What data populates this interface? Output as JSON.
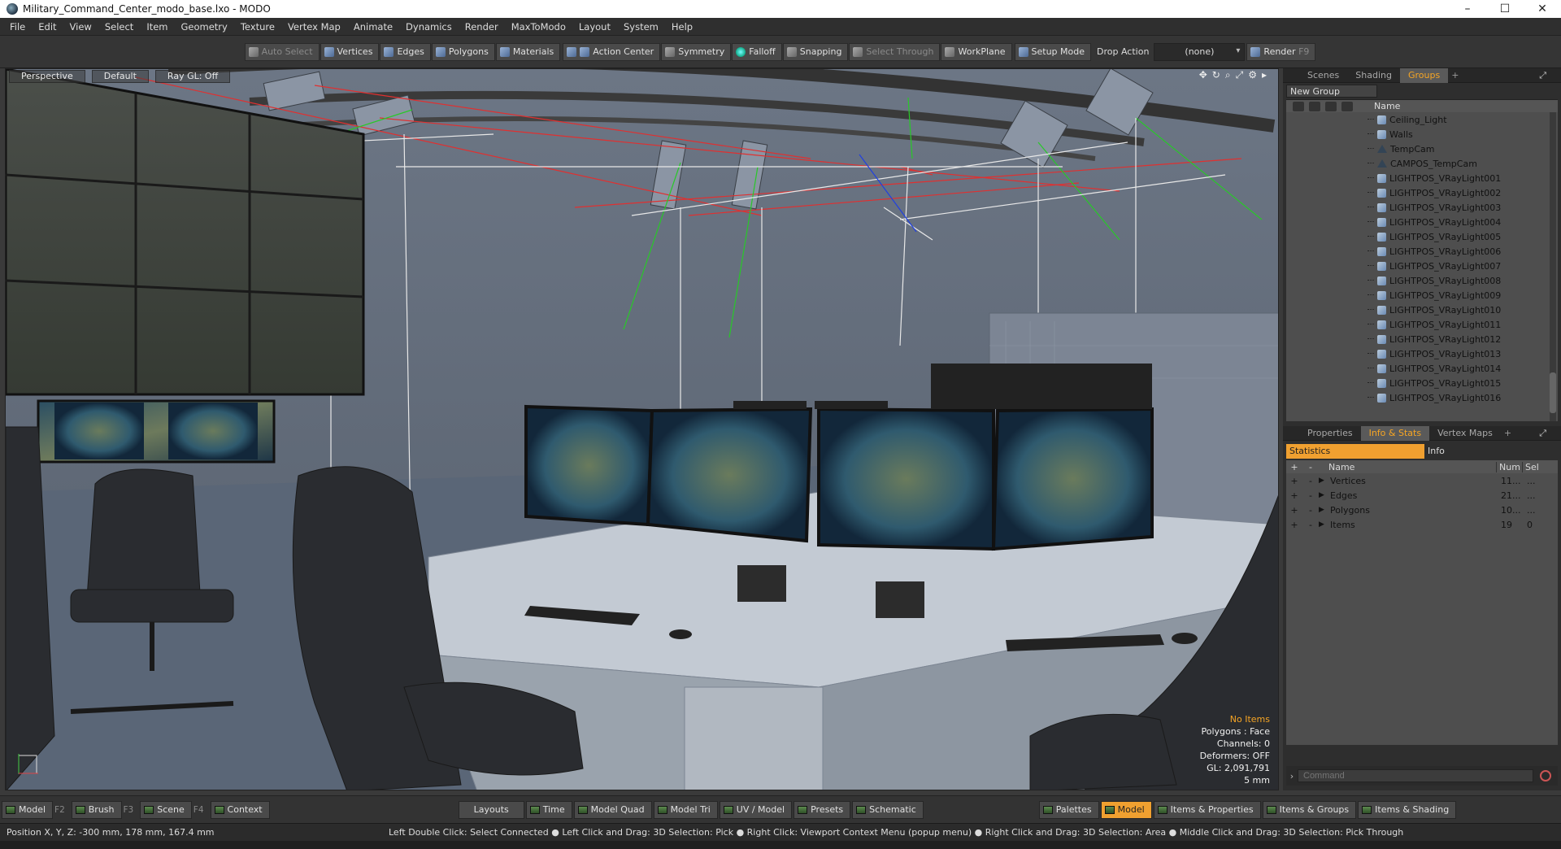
{
  "window": {
    "title": "Military_Command_Center_modo_base.lxo - MODO",
    "min": "–",
    "max": "☐",
    "close": "✕"
  },
  "menu": [
    "File",
    "Edit",
    "View",
    "Select",
    "Item",
    "Geometry",
    "Texture",
    "Vertex Map",
    "Animate",
    "Dynamics",
    "Render",
    "MaxToModo",
    "Layout",
    "System",
    "Help"
  ],
  "toolbar": {
    "auto_select": "Auto Select",
    "vertices": "Vertices",
    "edges": "Edges",
    "polygons": "Polygons",
    "materials": "Materials",
    "action_center": "Action Center",
    "symmetry": "Symmetry",
    "falloff": "Falloff",
    "snapping": "Snapping",
    "select_through": "Select Through",
    "workplane": "WorkPlane",
    "setup_mode": "Setup Mode",
    "drop_action": "Drop Action",
    "drop_value": "(none)",
    "render": "Render",
    "render_key": "F9"
  },
  "viewport": {
    "tabs": {
      "perspective": "Perspective",
      "default": "Default",
      "raygl": "Ray GL: Off"
    },
    "info": {
      "items": "No Items",
      "polygons": "Polygons : Face",
      "channels": "Channels: 0",
      "deformers": "Deformers: OFF",
      "gl": "GL: 2,091,791",
      "scale": "5 mm"
    }
  },
  "groups_panel": {
    "tabs": {
      "scenes": "Scenes",
      "shading": "Shading",
      "groups": "Groups"
    },
    "new_group": "New Group",
    "col_name": "Name",
    "items": [
      "Ceiling_Light",
      "Walls",
      "TempCam",
      "CAMPOS_TempCam",
      "LIGHTPOS_VRayLight001",
      "LIGHTPOS_VRayLight002",
      "LIGHTPOS_VRayLight003",
      "LIGHTPOS_VRayLight004",
      "LIGHTPOS_VRayLight005",
      "LIGHTPOS_VRayLight006",
      "LIGHTPOS_VRayLight007",
      "LIGHTPOS_VRayLight008",
      "LIGHTPOS_VRayLight009",
      "LIGHTPOS_VRayLight010",
      "LIGHTPOS_VRayLight011",
      "LIGHTPOS_VRayLight012",
      "LIGHTPOS_VRayLight013",
      "LIGHTPOS_VRayLight014",
      "LIGHTPOS_VRayLight015",
      "LIGHTPOS_VRayLight016"
    ]
  },
  "stats_panel": {
    "tabs": {
      "properties": "Properties",
      "info_stats": "Info & Stats",
      "vertex_maps": "Vertex Maps"
    },
    "subtabs": {
      "statistics": "Statistics",
      "info": "Info"
    },
    "cols": {
      "name": "Name",
      "num": "Num",
      "sel": "Sel"
    },
    "rows": [
      {
        "name": "Vertices",
        "num": "11...",
        "sel": "..."
      },
      {
        "name": "Edges",
        "num": "21...",
        "sel": "..."
      },
      {
        "name": "Polygons",
        "num": "10...",
        "sel": "..."
      },
      {
        "name": "Items",
        "num": "19",
        "sel": "0"
      }
    ],
    "command_placeholder": "Command"
  },
  "bottom": {
    "model": "Model",
    "model_key": "F2",
    "brush": "Brush",
    "brush_key": "F3",
    "scene": "Scene",
    "scene_key": "F4",
    "context": "Context",
    "layouts": "Layouts",
    "time": "Time",
    "model_quad": "Model Quad",
    "model_tri": "Model Tri",
    "uv_model": "UV / Model",
    "presets": "Presets",
    "schematic": "Schematic",
    "palettes": "Palettes",
    "model_active": "Model",
    "items_props": "Items & Properties",
    "items_groups": "Items & Groups",
    "items_shading": "Items & Shading"
  },
  "status": {
    "position": "Position X, Y, Z:   -300 mm, 178 mm, 167.4 mm",
    "hints": "Left Double Click: Select Connected ● Left Click and Drag: 3D Selection: Pick ● Right Click: Viewport Context Menu (popup menu) ● Right Click and Drag: 3D Selection: Area ● Middle Click and Drag: 3D Selection: Pick Through"
  }
}
